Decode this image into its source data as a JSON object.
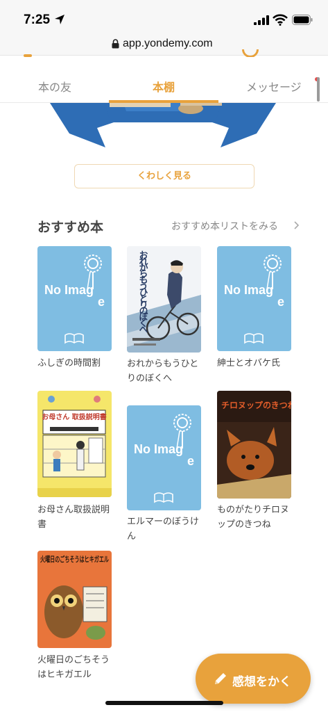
{
  "status_bar": {
    "time": "7:25"
  },
  "browser": {
    "url": "app.yondemy.com"
  },
  "tabs": [
    {
      "label": "本の友"
    },
    {
      "label": "本棚",
      "active": true
    },
    {
      "label": "メッセージ",
      "has_notification": true
    }
  ],
  "details_button": {
    "label": "くわしく見る"
  },
  "recommended": {
    "title": "おすすめ本",
    "list_link": "おすすめ本リストをみる"
  },
  "books": [
    {
      "title": "ふしぎの時間割",
      "cover": "no-image"
    },
    {
      "title": "おれからもうひとりのぼくへ",
      "cover": "illustration",
      "cover_text": "おれからもうひとりのぼくへ"
    },
    {
      "title": "紳士とオバケ氏",
      "cover": "no-image"
    },
    {
      "title": "お母さん取扱説明書",
      "cover": "illustration",
      "cover_text": "お母さん 取扱説明書"
    },
    {
      "title": "エルマーのぼうけん",
      "cover": "no-image"
    },
    {
      "title": "ものがたりチロヌップのきつね",
      "cover": "illustration",
      "cover_text": "チロヌップのきつね"
    },
    {
      "title": "火曜日のごちそうはヒキガエル",
      "cover": "illustration",
      "cover_text": "火曜日のごちそうはヒキガエル"
    }
  ],
  "no_image_text": {
    "line1": "No Imag",
    "line2": "e"
  },
  "fab": {
    "label": "感想をかく"
  },
  "colors": {
    "accent": "#e8a23c",
    "no_image_bg": "#7fbde2",
    "badge_blue": "#2e6db5"
  }
}
